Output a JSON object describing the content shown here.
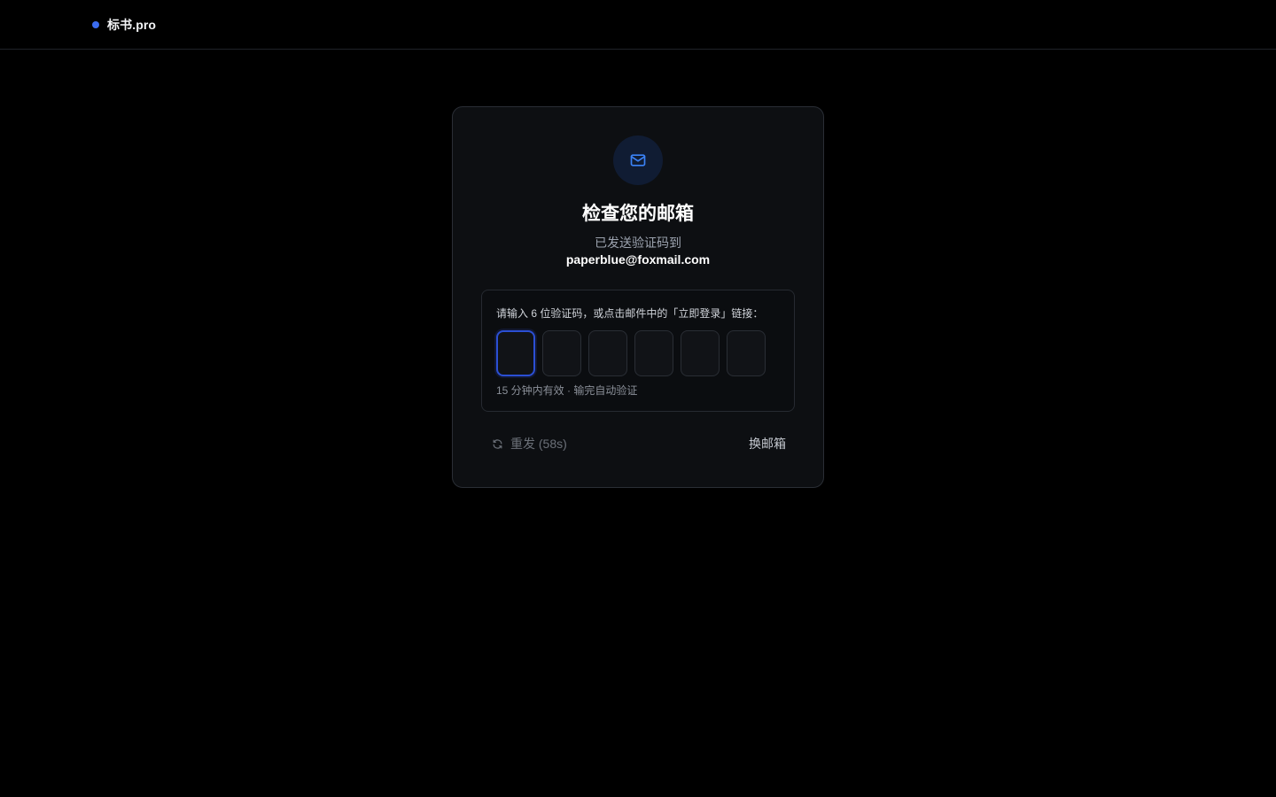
{
  "header": {
    "brand_name": "标书.pro"
  },
  "verify": {
    "icon": "mail-icon",
    "title": "检查您的邮箱",
    "subtitle": "已发送验证码到",
    "email": "paperblue@foxmail.com",
    "code_label": "请输入 6 位验证码，或点击邮件中的「立即登录」链接：",
    "code_values": [
      "",
      "",
      "",
      "",
      "",
      ""
    ],
    "code_hint": "15 分钟内有效 · 输完自动验证",
    "resend_label": "重发 (58s)",
    "resend_icon": "refresh-icon",
    "change_email_label": "换邮箱"
  },
  "colors": {
    "accent": "#3b6cf0",
    "focus_border": "#2b4fd4",
    "background": "#000000",
    "card": "#0d0f12"
  }
}
